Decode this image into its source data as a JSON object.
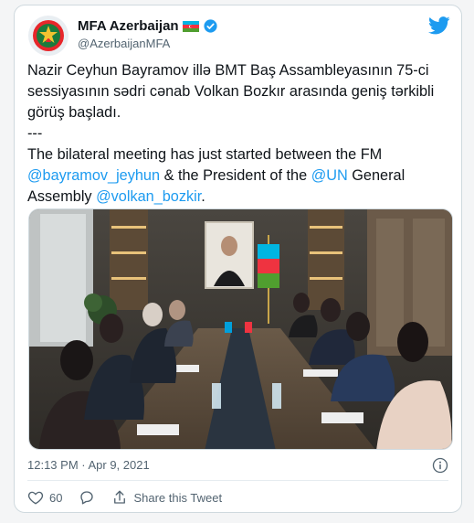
{
  "tweet": {
    "display_name": "MFA Azerbaijan",
    "handle": "@AzerbaijanMFA",
    "text_az": "Nazir Ceyhun Bayramov illə BMT Baş Assambleyasının 75-ci sessiyasının sədri cənab Volkan Bozkır arasında geniş tərkibli görüş başladı.",
    "separator": "---",
    "text_en_1": "The bilateral meeting has just started between the FM ",
    "mention_1": "@bayramov_jeyhun",
    "text_en_2": " & the President of the ",
    "mention_2": "@UN",
    "text_en_3": " General Assembly ",
    "mention_3": "@volkan_bozkir",
    "text_en_4": ".",
    "timestamp": "12:13 PM · Apr 9, 2021",
    "like_count": "60",
    "share_label": "Share this Tweet"
  },
  "icons": {
    "avatar": "azerbaijan-emblem-icon",
    "flag": "azerbaijan-flag-icon",
    "verified": "verified-badge-icon",
    "brand": "twitter-bird-icon",
    "info": "info-icon",
    "like": "heart-icon",
    "reply": "reply-icon",
    "share": "share-icon"
  },
  "colors": {
    "accent": "#1d9bf0",
    "text_primary": "#0f1419",
    "text_secondary": "#536471",
    "verified": "#1d9bf0"
  }
}
